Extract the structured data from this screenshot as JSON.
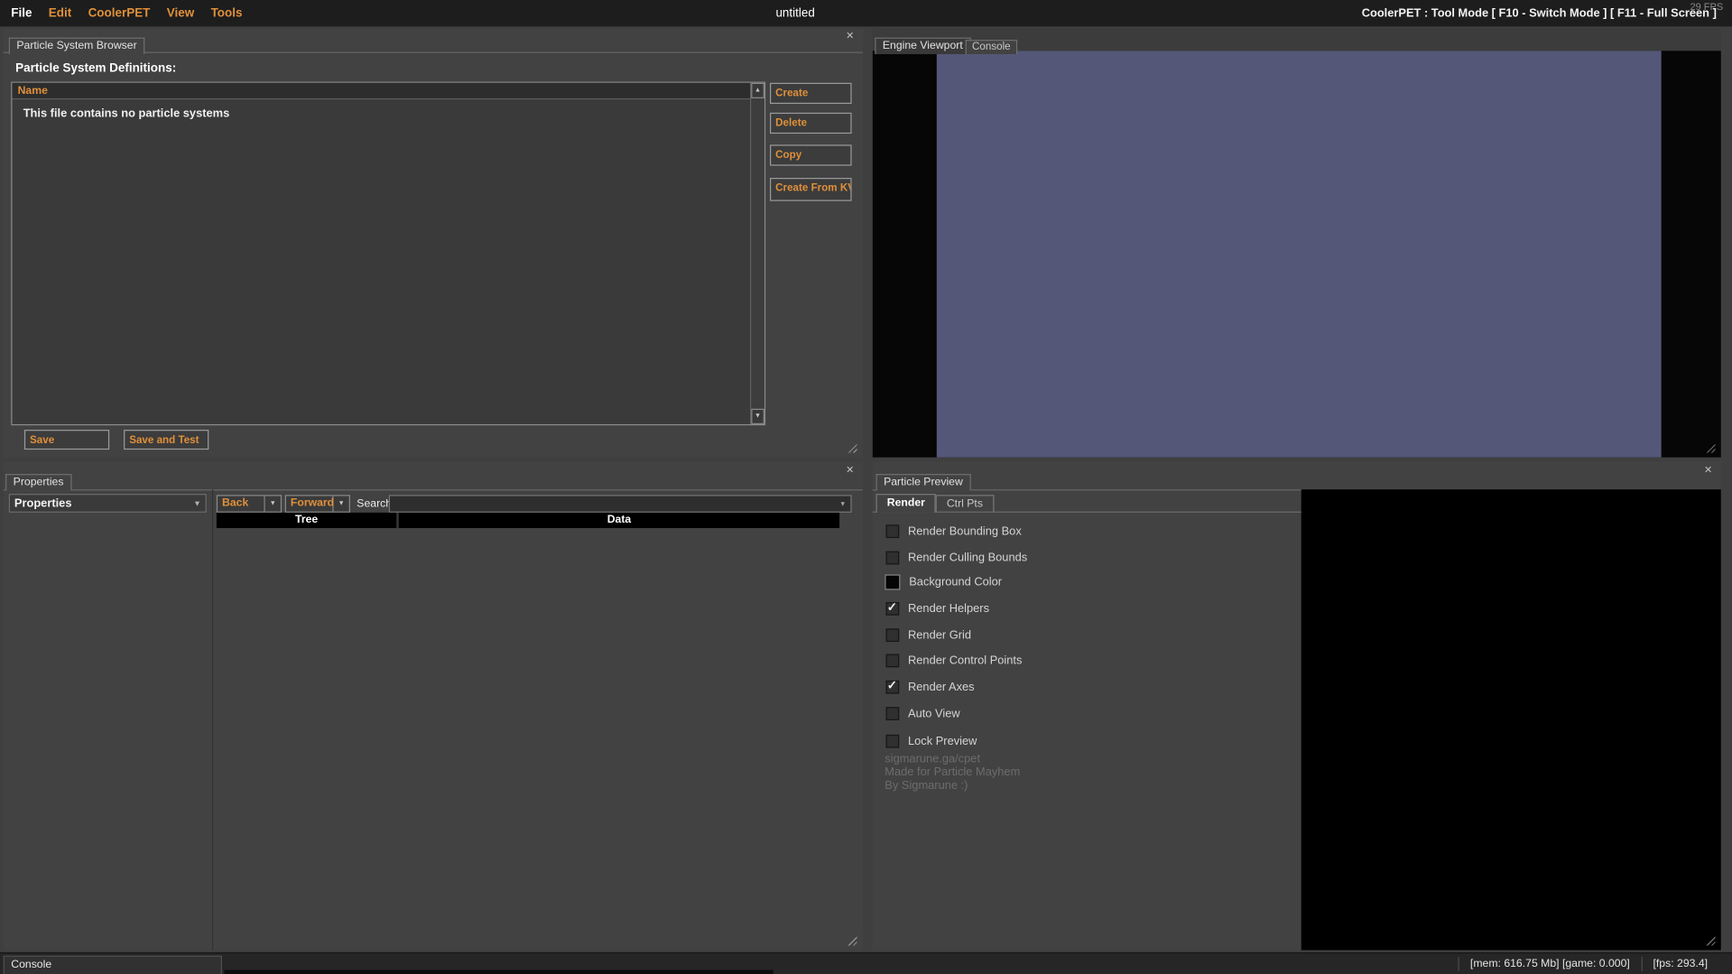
{
  "menu_bar": {
    "items": [
      "File",
      "Edit",
      "CoolerPET",
      "View",
      "Tools"
    ],
    "document_title": "untitled",
    "fps_overlay": "29 FPS",
    "mode_text": "CoolerPET : Tool Mode [ F10 - Switch Mode ] [ F11 - Full Screen ]"
  },
  "icons": {
    "close": "✕",
    "scroll_up": "▲",
    "scroll_down": "▼",
    "dropdown": "▼",
    "check": "✓"
  },
  "browser_panel": {
    "tab_label": "Particle System Browser",
    "heading": "Particle System Definitions:",
    "list_header": "Name",
    "empty_message": "This file contains no particle systems",
    "create_button": "Create",
    "delete_button": "Delete",
    "copy_button": "Copy",
    "create_from_kv_button": "Create From KV",
    "save_button": "Save",
    "save_and_test_button": "Save and Test"
  },
  "viewport_panel": {
    "engine_tab": "Engine Viewport",
    "console_tab": "Console"
  },
  "properties_panel": {
    "tab_label": "Properties",
    "selector_value": "Properties",
    "back_button": "Back",
    "forward_button": "Forward",
    "search_label": "Search:",
    "columns": [
      "Tree",
      "Data"
    ]
  },
  "preview_panel": {
    "tab_label": "Particle Preview",
    "render_tab": "Render",
    "ctrl_pts_tab": "Ctrl Pts",
    "options": [
      {
        "label": "Render Bounding Box",
        "checked": false
      },
      {
        "label": "Render Culling Bounds",
        "checked": false
      },
      {
        "label": "Background Color",
        "checked": false,
        "swatch": true
      },
      {
        "label": "Render Helpers",
        "checked": true
      },
      {
        "label": "Render Grid",
        "checked": false
      },
      {
        "label": "Render Control Points",
        "checked": false
      },
      {
        "label": "Render Axes",
        "checked": true
      },
      {
        "label": "Auto View",
        "checked": false
      },
      {
        "label": "Lock Preview",
        "checked": false
      }
    ],
    "credits": [
      "sigmarune.ga/cpet",
      "Made for Particle Mayhem",
      "By Sigmarune :)"
    ]
  },
  "status_bar": {
    "console_label": "Console",
    "mem_game_text": "[mem: 616.75 Mb] [game: 0.000]",
    "fps_text": "[fps:  293.4]"
  },
  "colors": {
    "accent_orange": "#e0903a",
    "viewport_purple": "#555778",
    "panel_bg": "#424242",
    "menubar_bg": "#1d1d1d"
  }
}
